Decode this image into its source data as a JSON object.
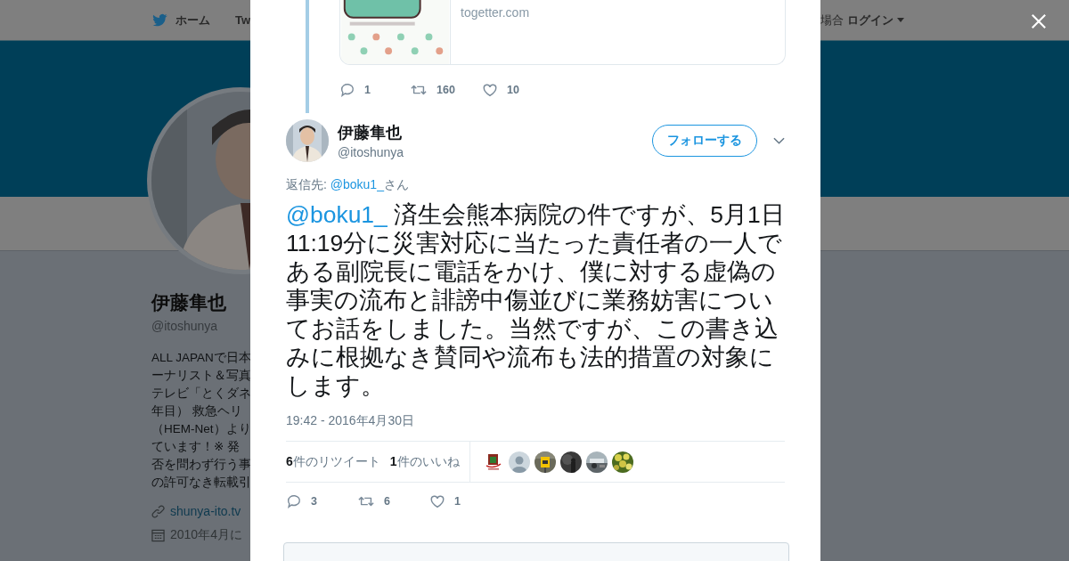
{
  "nav": {
    "home": "ホーム",
    "item_2": "Tw",
    "login_prefix": "場合",
    "login": "ログイン"
  },
  "profile": {
    "name": "伊藤隼也",
    "handle": "@itoshunya",
    "bio_lines": [
      "ALL JAPANで日本",
      "ーナリスト＆写真",
      "テレビ「とくダネ",
      "年目） 救急ヘリ",
      "（HEM-Net）より",
      "ています！※ 発",
      "否を問わず行う事",
      "の許可なき転載引"
    ],
    "website": "shunya-ito.tv",
    "joined": "2010年4月に"
  },
  "parent_tweet": {
    "card": {
      "domain": "togetter.com"
    },
    "actions": [
      {
        "kind": "reply",
        "count": "1"
      },
      {
        "kind": "retweet",
        "count": "160"
      },
      {
        "kind": "like",
        "count": "10"
      }
    ]
  },
  "tweet": {
    "author": {
      "name": "伊藤隼也",
      "handle": "@itoshunya"
    },
    "follow_button": "フォローする",
    "reply_to": {
      "label": "返信先: ",
      "mention": "@boku1_",
      "suffix": "さん"
    },
    "mention": "@boku1_",
    "text": "済生会熊本病院の件ですが、5月1日11:19分に災害対応に当たった責任者の一人である副院長に電話をかけ、僕に対する虚偽の事実の流布と誹謗中傷並びに業務妨害についてお話をしました。当然ですが、この書き込みに根拠なき賛同や流布も法的措置の対象にします。",
    "timestamp": "19:42 - 2016年4月30日",
    "stats": [
      "**6**件のリツイート",
      "**1**件のいいね"
    ],
    "likers": [
      {
        "kind": "picture"
      },
      {
        "kind": "picture"
      },
      {
        "kind": "picture"
      },
      {
        "kind": "picture"
      },
      {
        "kind": "picture"
      },
      {
        "kind": "picture"
      }
    ],
    "actions": [
      {
        "kind": "reply",
        "count": "3"
      },
      {
        "kind": "retweet",
        "count": "6"
      },
      {
        "kind": "like",
        "count": "1"
      }
    ]
  }
}
